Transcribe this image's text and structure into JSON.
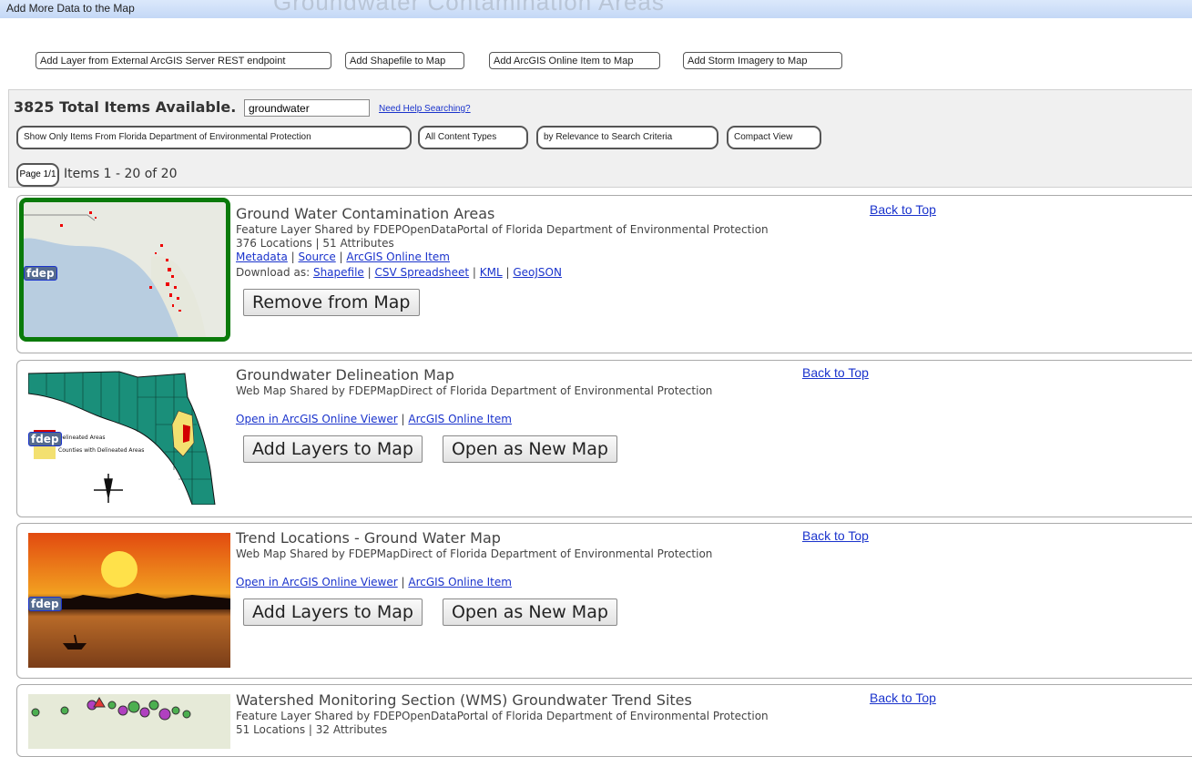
{
  "window": {
    "title": "Add More Data to the Map",
    "ghost_title": "Groundwater Contamination Areas"
  },
  "toolbar": {
    "buttons": [
      "Add Layer from External ArcGIS Server REST endpoint",
      "Add Shapefile to Map",
      "Add ArcGIS Online Item to Map",
      "Add Storm Imagery to Map"
    ]
  },
  "search": {
    "total_text": "3825 Total Items Available.",
    "query": "groundwater",
    "help_link": "Need Help Searching?",
    "filters": [
      "Show Only Items From Florida Department of Environmental Protection",
      "All Content Types",
      "by Relevance to Search Criteria",
      "Compact View"
    ],
    "page_label": "Page 1/1",
    "items_range": "Items 1 - 20 of 20"
  },
  "colors": {
    "link": "#1a33cc",
    "selected_border": "#0a7a0a",
    "badge_bg": "#556b8f"
  },
  "items": [
    {
      "title": "Ground Water Contamination Areas",
      "shared": "Feature Layer Shared by FDEPOpenDataPortal of Florida Department of Environmental Protection",
      "stats": "376 Locations | 51 Attributes",
      "links": [
        "Metadata",
        "Source",
        "ArcGIS Online Item"
      ],
      "download_label": "Download as:",
      "downloads": [
        "Shapefile",
        "CSV Spreadsheet",
        "KML",
        "GeoJSON"
      ],
      "buttons": [
        "Remove from Map"
      ],
      "badge": "fdep",
      "back_to_top": "Back to Top"
    },
    {
      "title": "Groundwater Delineation Map",
      "shared": "Web Map Shared by FDEPMapDirect of Florida Department of Environmental Protection",
      "links": [
        "Open in ArcGIS Online Viewer",
        "ArcGIS Online Item"
      ],
      "buttons": [
        "Add Layers to Map",
        "Open as New Map"
      ],
      "badge": "fdep",
      "legend": [
        "Delineated Areas",
        "Counties with Delineated Areas"
      ],
      "back_to_top": "Back to Top"
    },
    {
      "title": "Trend Locations - Ground Water Map",
      "shared": "Web Map Shared by FDEPMapDirect of Florida Department of Environmental Protection",
      "links": [
        "Open in ArcGIS Online Viewer",
        "ArcGIS Online Item"
      ],
      "buttons": [
        "Add Layers to Map",
        "Open as New Map"
      ],
      "badge": "fdep",
      "back_to_top": "Back to Top"
    },
    {
      "title": "Watershed Monitoring Section (WMS) Groundwater Trend Sites",
      "shared": "Feature Layer Shared by FDEPOpenDataPortal of Florida Department of Environmental Protection",
      "stats": "51 Locations | 32 Attributes",
      "back_to_top": "Back to Top"
    }
  ]
}
